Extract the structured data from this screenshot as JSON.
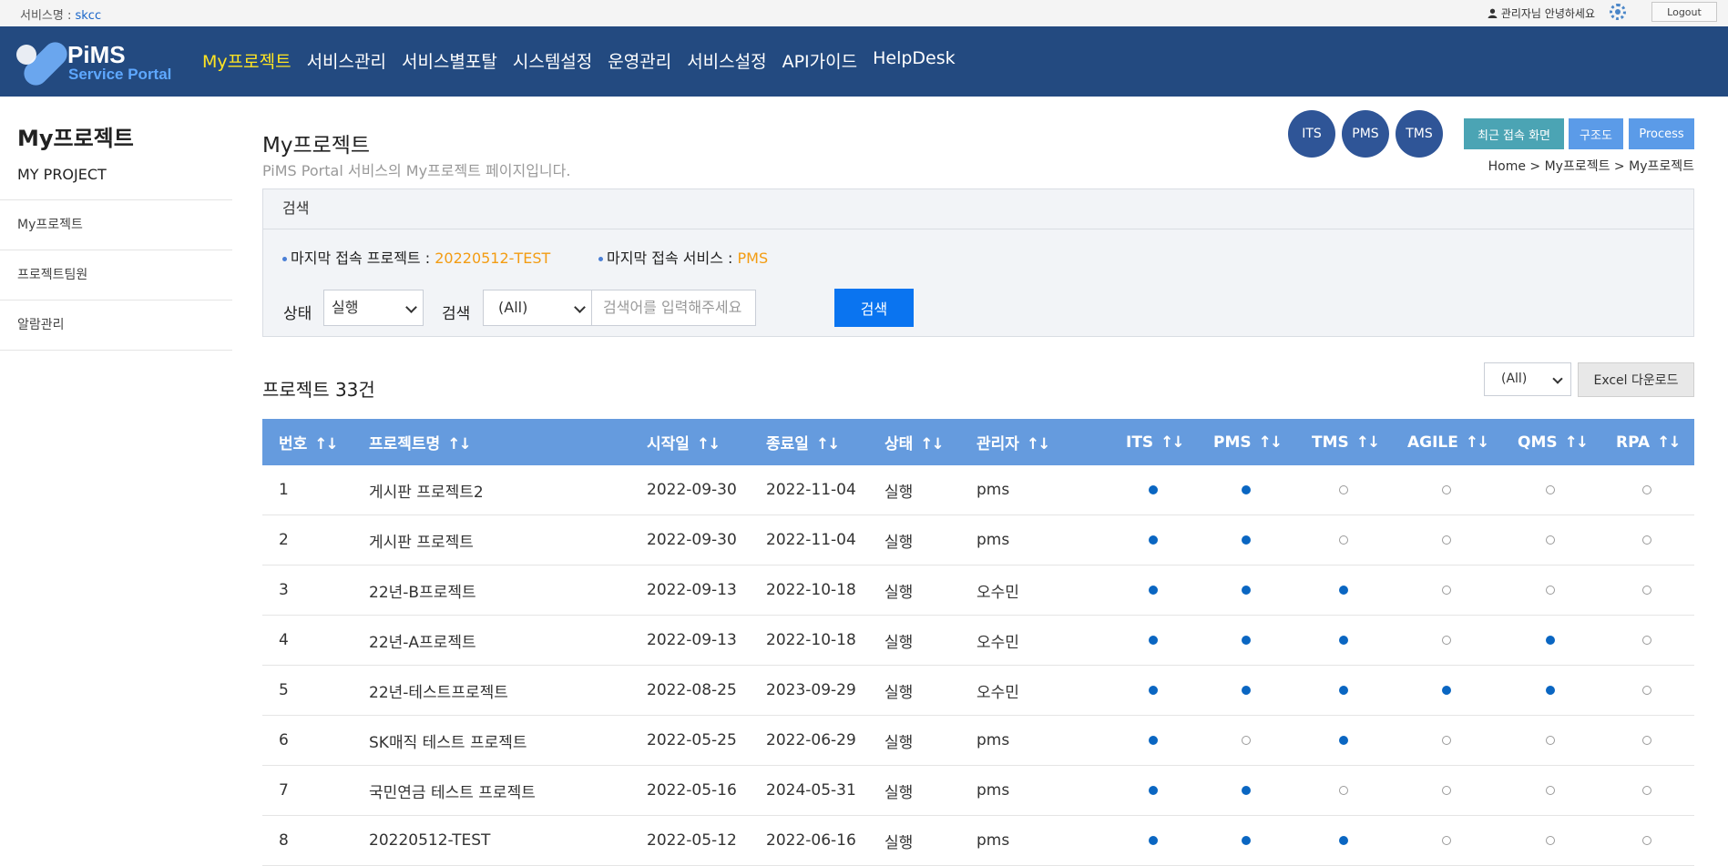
{
  "topbar": {
    "service_label": "서비스명 : ",
    "service_value": "skcc",
    "greeting": "관리자님 안녕하세요",
    "logout_label": "Logout"
  },
  "logo": {
    "line1": "PiMS",
    "line2": "Service Portal"
  },
  "nav": {
    "items": [
      "My프로젝트",
      "서비스관리",
      "서비스별포탈",
      "시스템설정",
      "운영관리",
      "서비스설정",
      "API가이드",
      "HelpDesk"
    ],
    "active_index": 0
  },
  "sidebar": {
    "title": "My프로젝트",
    "subtitle": "MY PROJECT",
    "items": [
      "My프로젝트",
      "프로젝트팀원",
      "알람관리"
    ]
  },
  "page": {
    "title": "My프로젝트",
    "description": "PiMS Portal 서비스의 My프로젝트 페이지입니다.",
    "service_circles": [
      "ITS",
      "PMS",
      "TMS"
    ],
    "quick_buttons": [
      {
        "label": "최근 접속 화면",
        "color": "#4ba4b4"
      },
      {
        "label": "구조도",
        "color": "#5b9be8"
      },
      {
        "label": "Process",
        "color": "#5b9be8"
      }
    ],
    "breadcrumb": "Home > My프로젝트 > My프로젝트"
  },
  "search": {
    "header": "검색",
    "last_project_label": "마지막 접속 프로젝트 : ",
    "last_project_value": "20220512-TEST",
    "last_service_label": "마지막 접속 서비스 : ",
    "last_service_value": "PMS",
    "status_label": "상태",
    "status_value": "실행",
    "search_label": "검색",
    "search_type_value": "(All)",
    "search_placeholder": "검색어를 입력해주세요",
    "search_button": "검색"
  },
  "list": {
    "count_text": "프로젝트 33건",
    "filter_value": "(All)",
    "excel_button": "Excel 다운로드"
  },
  "table": {
    "columns": [
      "번호",
      "프로젝트명",
      "시작일",
      "종료일",
      "상태",
      "관리자",
      "ITS",
      "PMS",
      "TMS",
      "AGILE",
      "QMS",
      "RPA"
    ],
    "sort_glyph": "↑↓",
    "rows": [
      {
        "no": "1",
        "name": "게시판 프로젝트2",
        "start": "2022-09-30",
        "end": "2022-11-04",
        "status": "실행",
        "manager": "pms",
        "flags": [
          1,
          1,
          0,
          0,
          0,
          0
        ]
      },
      {
        "no": "2",
        "name": "게시판 프로젝트",
        "start": "2022-09-30",
        "end": "2022-11-04",
        "status": "실행",
        "manager": "pms",
        "flags": [
          1,
          1,
          0,
          0,
          0,
          0
        ]
      },
      {
        "no": "3",
        "name": "22년-B프로젝트",
        "start": "2022-09-13",
        "end": "2022-10-18",
        "status": "실행",
        "manager": "오수민",
        "flags": [
          1,
          1,
          1,
          0,
          0,
          0
        ]
      },
      {
        "no": "4",
        "name": "22년-A프로젝트",
        "start": "2022-09-13",
        "end": "2022-10-18",
        "status": "실행",
        "manager": "오수민",
        "flags": [
          1,
          1,
          1,
          0,
          1,
          0
        ]
      },
      {
        "no": "5",
        "name": "22년-테스트프로젝트",
        "start": "2022-08-25",
        "end": "2023-09-29",
        "status": "실행",
        "manager": "오수민",
        "flags": [
          1,
          1,
          1,
          1,
          1,
          0
        ]
      },
      {
        "no": "6",
        "name": "SK매직 테스트 프로젝트",
        "start": "2022-05-25",
        "end": "2022-06-29",
        "status": "실행",
        "manager": "pms",
        "flags": [
          1,
          0,
          1,
          0,
          0,
          0
        ]
      },
      {
        "no": "7",
        "name": "국민연금 테스트 프로젝트",
        "start": "2022-05-16",
        "end": "2024-05-31",
        "status": "실행",
        "manager": "pms",
        "flags": [
          1,
          1,
          0,
          0,
          0,
          0
        ]
      },
      {
        "no": "8",
        "name": "20220512-TEST",
        "start": "2022-05-12",
        "end": "2022-06-16",
        "status": "실행",
        "manager": "pms",
        "flags": [
          1,
          1,
          1,
          0,
          0,
          0
        ]
      }
    ]
  }
}
